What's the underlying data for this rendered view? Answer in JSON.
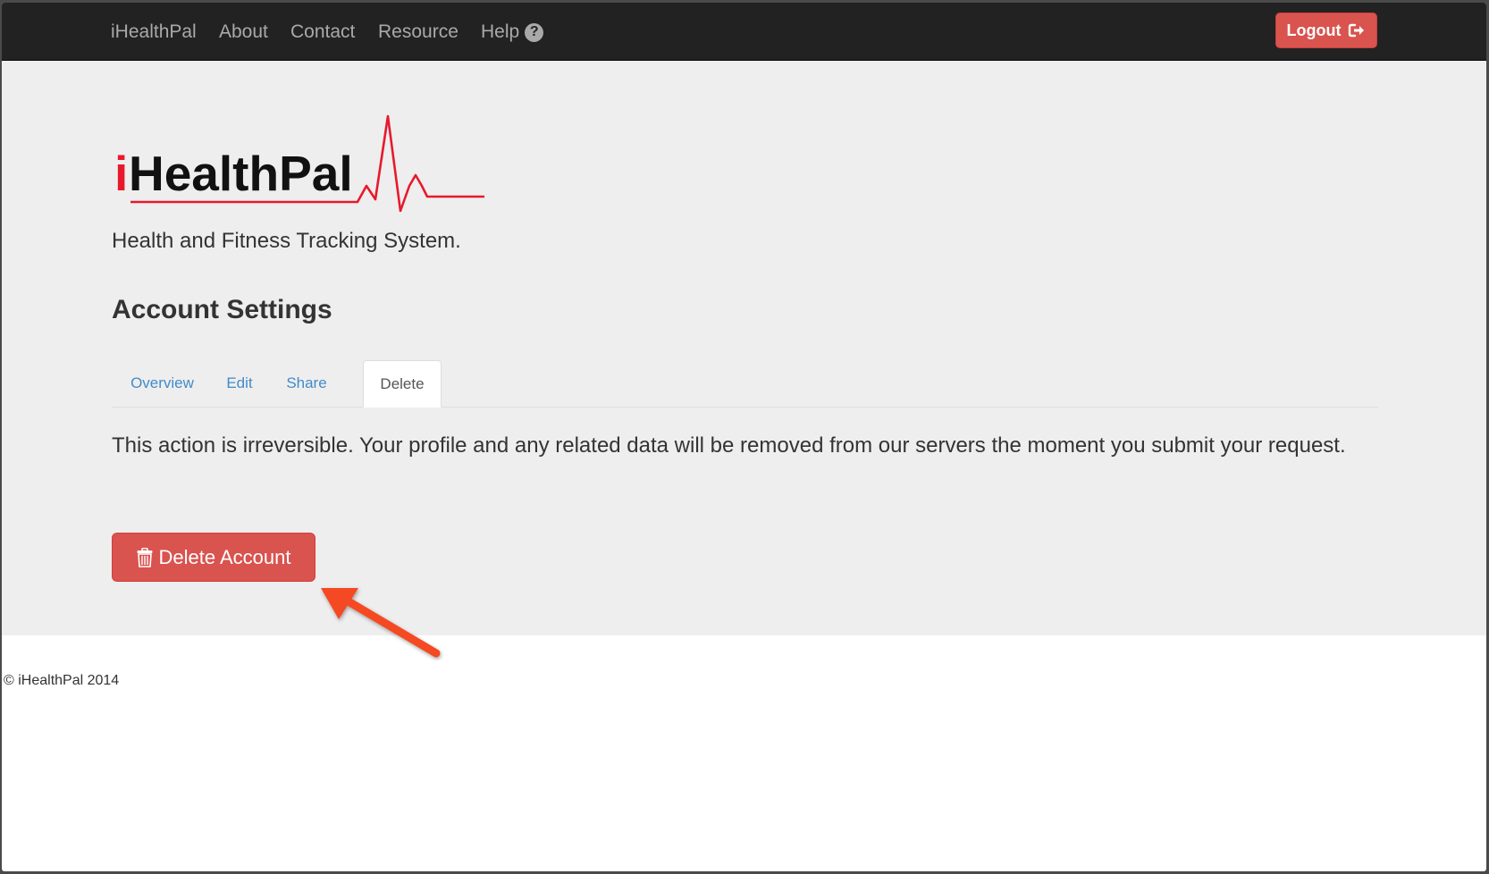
{
  "navbar": {
    "brand": "iHealthPal",
    "links": [
      "About",
      "Contact",
      "Resource"
    ],
    "help_label": "Help",
    "help_icon": "question-circle-icon",
    "logout_label": "Logout",
    "logout_icon": "sign-out-icon"
  },
  "header": {
    "logo_text_i": "i",
    "logo_text_rest": "HealthPal",
    "tagline": "Health and Fitness Tracking System.",
    "title": "Account Settings"
  },
  "tabs": {
    "items": [
      "Overview",
      "Edit",
      "Share",
      "Delete"
    ],
    "active": "Delete"
  },
  "delete_panel": {
    "warning": "This action is irreversible. Your profile and any related data will be removed from our servers the moment you submit your request.",
    "button_label": "Delete Account",
    "button_icon": "trash-icon"
  },
  "footer": {
    "copyright": "© iHealthPal 2014"
  },
  "colors": {
    "navbar_bg": "#222222",
    "danger": "#d9534f",
    "link": "#428bca",
    "annotation_arrow": "#f44a21",
    "logo_red": "#e8192c"
  }
}
